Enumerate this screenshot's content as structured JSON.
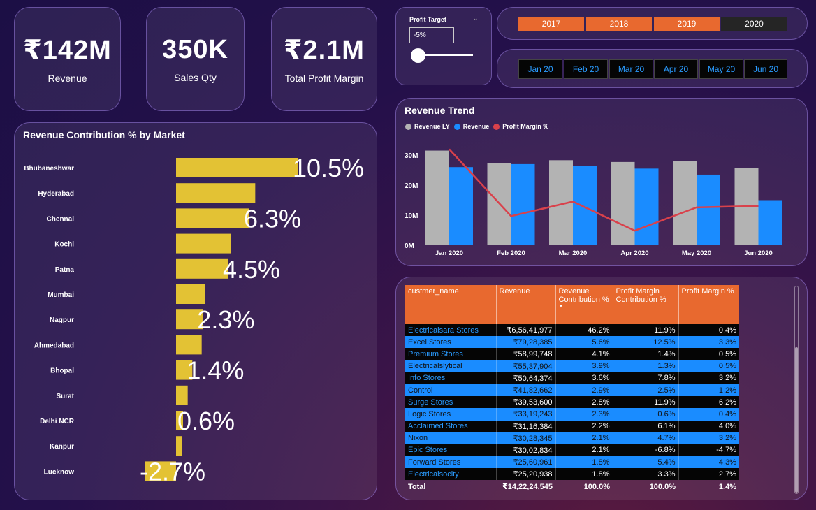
{
  "kpis": [
    {
      "value": "₹142M",
      "label": "Revenue"
    },
    {
      "value": "350K",
      "label": "Sales Qty"
    },
    {
      "value": "₹2.1M",
      "label": "Total Profit Margin"
    }
  ],
  "profit_target": {
    "title": "Profit Target",
    "value": "-5%"
  },
  "years": [
    "2017",
    "2018",
    "2019",
    "2020"
  ],
  "selected_year": "2020",
  "months": [
    "Jan 20",
    "Feb 20",
    "Mar 20",
    "Apr 20",
    "May 20",
    "Jun 20"
  ],
  "colors": {
    "bar_yellow": "#e3c234",
    "revenue_ly": "#b3b3b3",
    "revenue": "#1a8cff",
    "margin_line": "#d9414b",
    "header_orange": "#e8692f"
  },
  "market_chart": {
    "title": "Revenue Contribution % by Market",
    "markets": [
      "Bhubaneshwar",
      "Hyderabad",
      "Chennai",
      "Kochi",
      "Patna",
      "Mumbai",
      "Nagpur",
      "Ahmedabad",
      "Bhopal",
      "Surat",
      "Delhi NCR",
      "Kanpur",
      "Lucknow"
    ],
    "shown_labels": [
      "10.5%",
      "",
      "6.3%",
      "",
      "4.5%",
      "",
      "2.3%",
      "",
      "1.4%",
      "",
      "0.6%",
      "",
      "-2.7%"
    ]
  },
  "trend_chart": {
    "title": "Revenue Trend",
    "legend": [
      "Revenue LY",
      "Revenue",
      "Profit Margin %"
    ],
    "y_ticks": [
      "0M",
      "10M",
      "20M",
      "30M"
    ]
  },
  "chart_data": [
    {
      "type": "bar",
      "orientation": "horizontal",
      "title": "Revenue Contribution % by Market",
      "categories": [
        "Bhubaneshwar",
        "Hyderabad",
        "Chennai",
        "Kochi",
        "Patna",
        "Mumbai",
        "Nagpur",
        "Ahmedabad",
        "Bhopal",
        "Surat",
        "Delhi NCR",
        "Kanpur",
        "Lucknow"
      ],
      "values": [
        10.5,
        6.8,
        6.3,
        4.7,
        4.5,
        2.5,
        2.3,
        2.2,
        1.4,
        1.0,
        0.6,
        0.5,
        -2.7
      ],
      "unit": "%"
    },
    {
      "type": "bar",
      "title": "Revenue Trend",
      "categories": [
        "Jan 2020",
        "Feb 2020",
        "Mar 2020",
        "Apr 2020",
        "May 2020",
        "Jun 2020"
      ],
      "series": [
        {
          "name": "Revenue LY",
          "values": [
            31.5,
            27.3,
            28.3,
            27.7,
            28.1,
            25.6
          ]
        },
        {
          "name": "Revenue",
          "values": [
            26.0,
            27.0,
            26.5,
            25.5,
            23.5,
            15.0
          ]
        }
      ],
      "line_series": {
        "name": "Profit Margin %",
        "values": [
          3.3,
          1.0,
          1.5,
          0.5,
          1.3,
          1.35
        ]
      },
      "ylim": [
        0,
        33
      ],
      "unit": "M",
      "y2_hidden": true
    }
  ],
  "table": {
    "headers": [
      "custmer_name",
      "Revenue",
      "Revenue Contribution %",
      "Profit Margin Contribution %",
      "Profit Margin %"
    ],
    "rows": [
      [
        "Electricalsara Stores",
        "₹6,56,41,977",
        "46.2%",
        "11.9%",
        "0.4%"
      ],
      [
        "Excel Stores",
        "₹79,28,385",
        "5.6%",
        "12.5%",
        "3.3%"
      ],
      [
        "Premium Stores",
        "₹58,99,748",
        "4.1%",
        "1.4%",
        "0.5%"
      ],
      [
        "Electricalslytical",
        "₹55,37,904",
        "3.9%",
        "1.3%",
        "0.5%"
      ],
      [
        "Info Stores",
        "₹50,64,374",
        "3.6%",
        "7.8%",
        "3.2%"
      ],
      [
        "Control",
        "₹41,82,662",
        "2.9%",
        "2.5%",
        "1.2%"
      ],
      [
        "Surge Stores",
        "₹39,53,600",
        "2.8%",
        "11.9%",
        "6.2%"
      ],
      [
        "Logic Stores",
        "₹33,19,243",
        "2.3%",
        "0.6%",
        "0.4%"
      ],
      [
        "Acclaimed Stores",
        "₹31,16,384",
        "2.2%",
        "6.1%",
        "4.0%"
      ],
      [
        "Nixon",
        "₹30,28,345",
        "2.1%",
        "4.7%",
        "3.2%"
      ],
      [
        "Epic Stores",
        "₹30,02,834",
        "2.1%",
        "-6.8%",
        "-4.7%"
      ],
      [
        "Forward Stores",
        "₹25,60,961",
        "1.8%",
        "5.4%",
        "4.3%"
      ],
      [
        "Electricalsocity",
        "₹25,20,938",
        "1.8%",
        "3.3%",
        "2.7%"
      ]
    ],
    "total": [
      "Total",
      "₹14,22,24,545",
      "100.0%",
      "100.0%",
      "1.4%"
    ]
  }
}
